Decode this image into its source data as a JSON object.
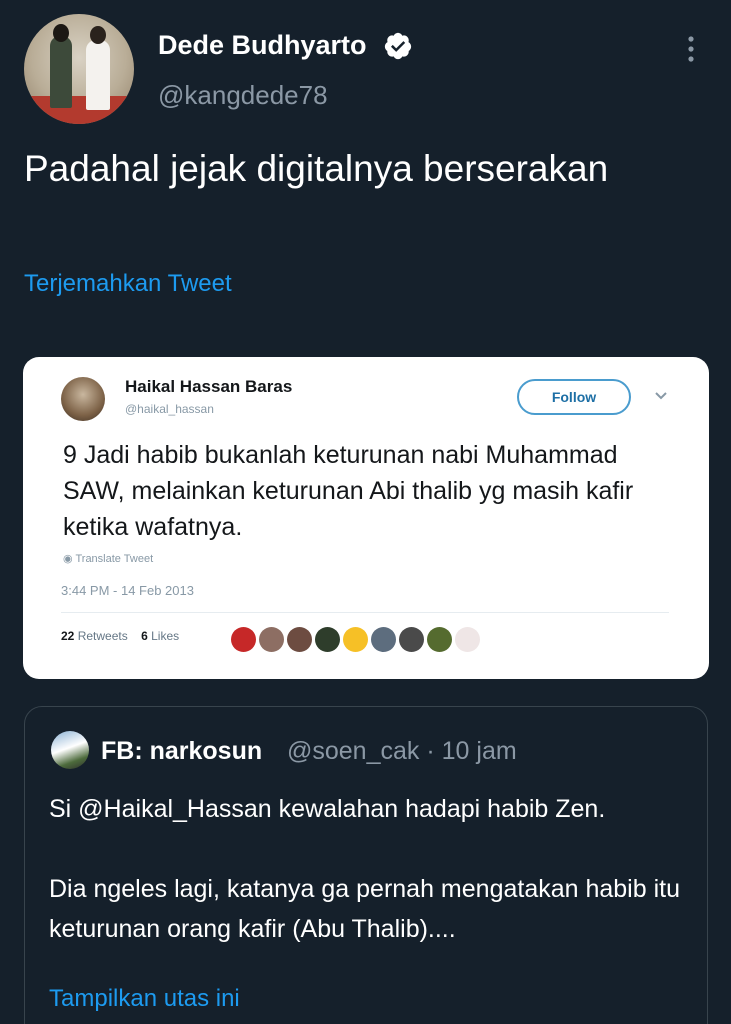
{
  "tweet": {
    "author_name": "Dede Budhyarto",
    "author_handle": "@kangdede78",
    "text": "Padahal jejak digitalnya berserakan",
    "translate_label": "Terjemahkan Tweet",
    "icons": {
      "verified": "verified-badge-icon",
      "more": "more-options-icon"
    }
  },
  "embedded_screenshot": {
    "name": "Haikal Hassan Baras",
    "handle": "@haikal_hassan",
    "follow_label": "Follow",
    "text": "9 Jadi habib bukanlah keturunan nabi Muhammad SAW, melainkan keturunan Abi thalib yg masih kafir ketika wafatnya.",
    "translate_label": "Translate Tweet",
    "timestamp": "3:44 PM - 14 Feb 2013",
    "retweets_count": "22",
    "retweets_label": "Retweets",
    "likes_count": "6",
    "likes_label": "Likes",
    "liker_colors": [
      "#c62828",
      "#8d6e63",
      "#6d4c41",
      "#2e3d2b",
      "#f6c026",
      "#5d6d7e",
      "#4a4a4a",
      "#556b2f",
      "#efe6e6"
    ]
  },
  "quoted_tweet": {
    "author_name": "FB: narkosun",
    "author_handle": "@soen_cak",
    "time": "10 jam",
    "separator": "·",
    "paragraph1": "Si @Haikal_Hassan kewalahan hadapi habib Zen.",
    "paragraph2": "Dia ngeles lagi, katanya ga pernah mengatakan habib itu keturunan orang kafir (Abu Thalib)....",
    "show_thread_label": "Tampilkan utas ini"
  },
  "colors": {
    "background": "#15202b",
    "link": "#1d9bf0",
    "secondary_text": "#8b98a5"
  }
}
